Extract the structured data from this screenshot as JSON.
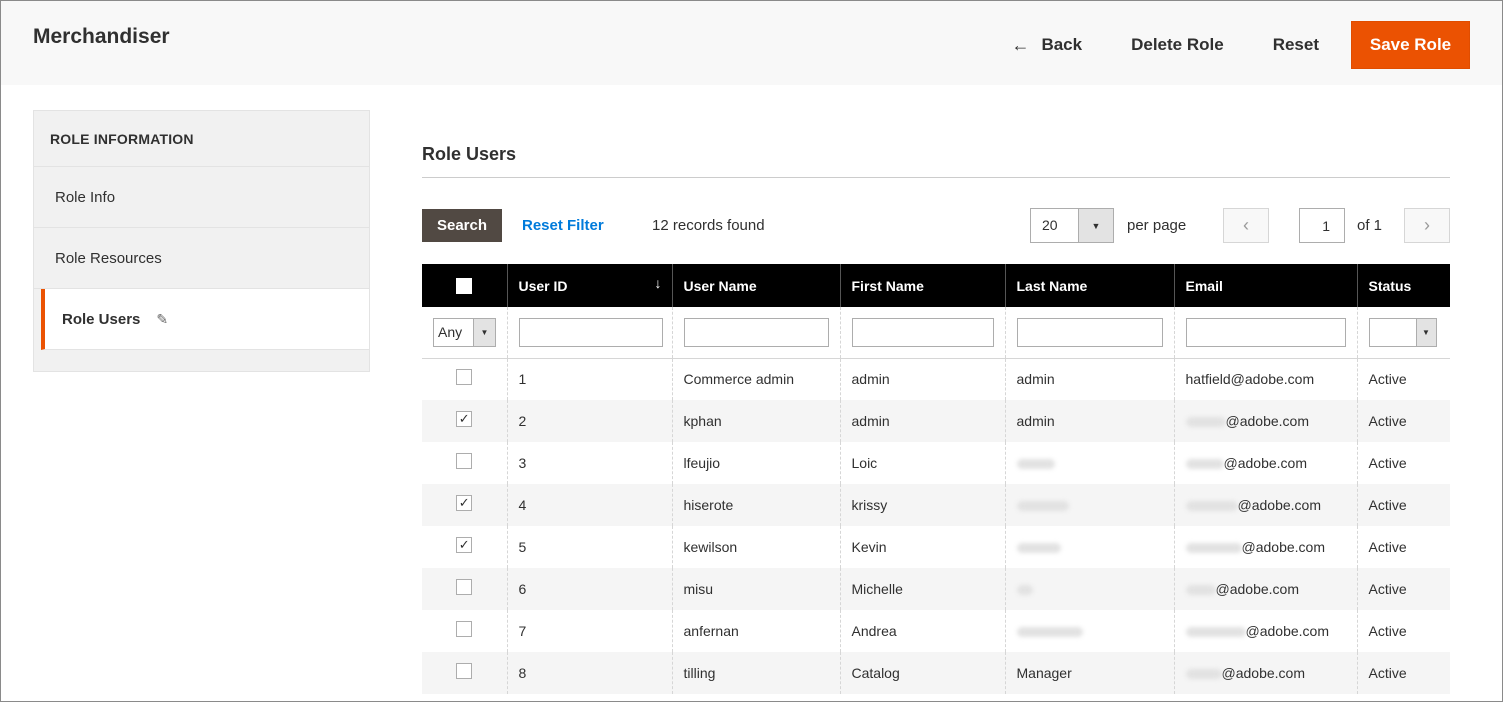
{
  "header": {
    "title": "Merchandiser",
    "back_label": "Back",
    "delete_label": "Delete Role",
    "reset_label": "Reset",
    "save_label": "Save Role",
    "accent_color": "#eb5202"
  },
  "sidebar": {
    "title": "ROLE INFORMATION",
    "items": [
      {
        "label": "Role Info",
        "active": false
      },
      {
        "label": "Role Resources",
        "active": false
      },
      {
        "label": "Role Users",
        "active": true
      }
    ]
  },
  "section": {
    "title": "Role Users"
  },
  "toolbar": {
    "search_label": "Search",
    "reset_filter_label": "Reset Filter",
    "records_found": "12 records found",
    "per_page_value": "20",
    "per_page_label": "per page",
    "current_page": "1",
    "of_label": "of 1"
  },
  "grid": {
    "columns": [
      "User ID",
      "User Name",
      "First Name",
      "Last Name",
      "Email",
      "Status"
    ],
    "filter_any": "Any",
    "rows": [
      {
        "checked": false,
        "id": "1",
        "username": "Commerce admin",
        "first": "admin",
        "last": "admin",
        "email": "hatfield@adobe.com",
        "status": "Active"
      },
      {
        "checked": true,
        "id": "2",
        "username": "kphan",
        "first": "admin",
        "last": "admin",
        "email": "@adobe.com",
        "status": "Active"
      },
      {
        "checked": false,
        "id": "3",
        "username": "lfeujio",
        "first": "Loic",
        "last": "",
        "email": "@adobe.com",
        "status": "Active"
      },
      {
        "checked": true,
        "id": "4",
        "username": "hiserote",
        "first": "krissy",
        "last": "",
        "email": "@adobe.com",
        "status": "Active"
      },
      {
        "checked": true,
        "id": "5",
        "username": "kewilson",
        "first": "Kevin",
        "last": "",
        "email": "@adobe.com",
        "status": "Active"
      },
      {
        "checked": false,
        "id": "6",
        "username": "misu",
        "first": "Michelle",
        "last": "",
        "email": "@adobe.com",
        "status": "Active"
      },
      {
        "checked": false,
        "id": "7",
        "username": "anfernan",
        "first": "Andrea",
        "last": "",
        "email": "@adobe.com",
        "status": "Active"
      },
      {
        "checked": false,
        "id": "8",
        "username": "tilling",
        "first": "Catalog",
        "last": "Manager",
        "email": "@adobe.com",
        "status": "Active"
      }
    ]
  }
}
